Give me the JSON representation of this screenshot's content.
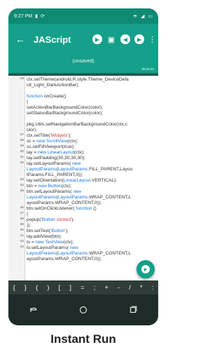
{
  "status_bar": {
    "time": "9:27 PM",
    "left_icons": [
      "sim-icon",
      "refresh-icon"
    ],
    "right_icons": [
      "wifi-icon",
      "signal-icon",
      "battery-icon"
    ]
  },
  "app": {
    "title": "JAScript",
    "subtitle": "(unsaved)",
    "timer": "00:00:23",
    "actions": [
      "play-icon",
      "save-icon",
      "undo-icon",
      "redo-icon",
      "more-icon"
    ]
  },
  "editor": {
    "lines": [
      {
        "n": "18",
        "t": "ctx.setTheme(android.R.style.Theme_DeviceDefa"
      },
      {
        "n": "",
        "t": "ult_Light_DarkActionBar);"
      },
      {
        "n": "",
        "t": ""
      },
      {
        "n": "",
        "t": "  function onCreate()"
      },
      {
        "n": "",
        "t": "  {"
      },
      {
        "n": "",
        "t": "    setActionBarBackgroundColor(color);"
      },
      {
        "n": "",
        "t": "    setStatusBarBackgroundColor(color);"
      },
      {
        "n": "",
        "t": ""
      },
      {
        "n": "",
        "t": "pkg.Utils.setNavigationBarBackgroundColor(ctx,c"
      },
      {
        "n": "",
        "t": "olor);"
      },
      {
        "n": "27",
        "t": "    ctx.setTitle('Widgets');"
      },
      {
        "n": "28",
        "t": "    sc = new ScrollView(ctx);"
      },
      {
        "n": "29",
        "t": "    sc.setFillViewport(true);"
      },
      {
        "n": "30",
        "t": "    lay = new LinearLayout(ctx);"
      },
      {
        "n": "31",
        "t": "    lay.setPadding(30,30,30,30);"
      },
      {
        "n": "32",
        "t": "    lay.setLayoutParams( new"
      },
      {
        "n": "",
        "t": "LayoutParams(LayoutParams.FILL_PARENT,Layou"
      },
      {
        "n": "",
        "t": "tParams.FILL_PARENT,0));"
      },
      {
        "n": "33",
        "t": "    lay.setOrientation(LinearLayout.VERTICAL);"
      },
      {
        "n": "34",
        "t": "    btn = new Button(ctx);"
      },
      {
        "n": "35",
        "t": "    btn.setLayoutParams( new"
      },
      {
        "n": "",
        "t": "LayoutParams(LayoutParams.WRAP_CONTENT,L"
      },
      {
        "n": "",
        "t": "ayoutParams.WRAP_CONTENT,0));"
      },
      {
        "n": "36",
        "t": "    btn.setOnClickListener( function ()"
      },
      {
        "n": "37",
        "t": "    {"
      },
      {
        "n": "38",
        "t": "      popup('Button clicked');"
      },
      {
        "n": "39",
        "t": "    });"
      },
      {
        "n": "40",
        "t": "    btn.setText('Button');"
      },
      {
        "n": "41",
        "t": "    lay.addView(btn);"
      },
      {
        "n": "42",
        "t": "    tv = new TextView(ctx);"
      },
      {
        "n": "43",
        "t": "    tv.setLayoutParams( new"
      },
      {
        "n": "",
        "t": "LayoutParams(LayoutParams.WRAP_CONTENT,L"
      },
      {
        "n": "",
        "t": "ayoutParams.WRAP_CONTENT,0));"
      }
    ]
  },
  "symbols": [
    "{",
    "}",
    "(",
    ")",
    "[",
    "]",
    "=",
    ";",
    "+",
    "-",
    "/",
    "*",
    ":"
  ],
  "nav": {
    "back": "back-icon",
    "home": "home-icon",
    "recents": "recents-icon"
  },
  "caption": "Instant Run",
  "colors": {
    "accent": "#14a08a",
    "dark": "#2f3d38",
    "keyword": "#1a74d8",
    "string": "#d03a3a"
  }
}
